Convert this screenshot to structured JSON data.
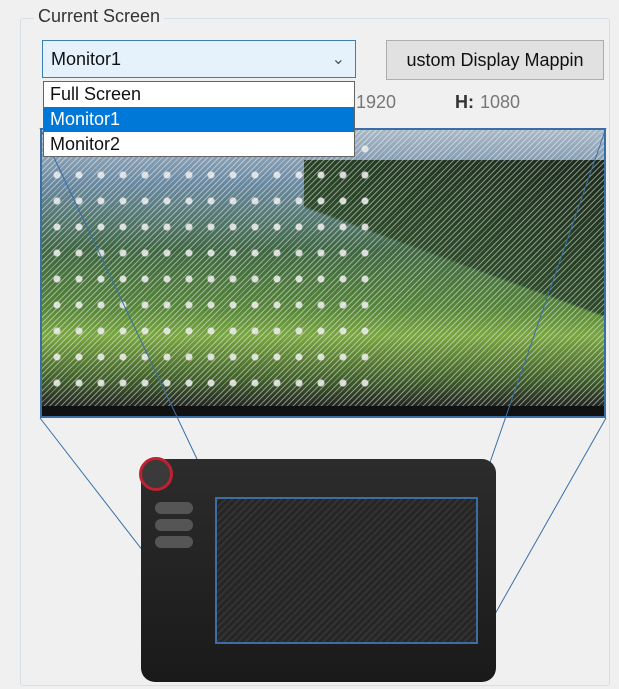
{
  "group": {
    "title": "Current Screen"
  },
  "screen_select": {
    "value": "Monitor1",
    "options": [
      "Full Screen",
      "Monitor1",
      "Monitor2"
    ],
    "selected_index": 1
  },
  "custom_mapping_button": {
    "label": "ustom Display Mappin"
  },
  "resolution": {
    "width_value": "1920",
    "height_label": "H:",
    "height_value": "1080"
  },
  "colors": {
    "accent": "#3a6ea5",
    "selection": "#0078d7",
    "dial_ring": "#c02030"
  },
  "icons": [
    "chevron-down-icon",
    "desktop-icons",
    "wacom-dial-icon"
  ]
}
